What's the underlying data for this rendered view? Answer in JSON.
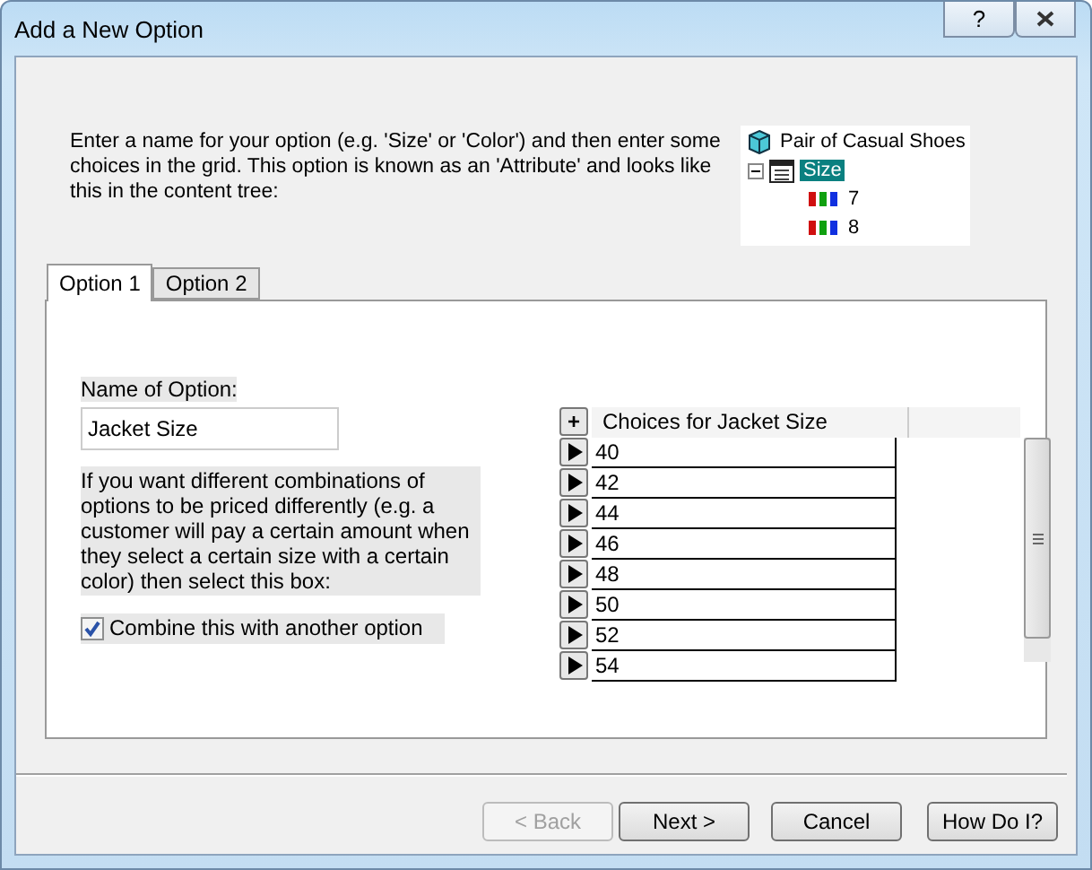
{
  "window": {
    "title": "Add a New Option",
    "help_button": "?"
  },
  "intro": "Enter a name for your option (e.g. 'Size' or 'Color') and then enter some choices in the grid. This option is known as an 'Attribute' and looks like this in the content tree:",
  "tree": {
    "label": "Pair of Casual Shoes",
    "children": [
      {
        "label": "Size",
        "selected": true,
        "expanded": true,
        "children": [
          {
            "label": "7"
          },
          {
            "label": "8"
          }
        ]
      }
    ]
  },
  "tabs": [
    {
      "label": "Option 1",
      "selected": true
    },
    {
      "label": "Option 2",
      "selected": false
    }
  ],
  "name_label": "Name of Option:",
  "name_value": "Jacket Size",
  "combine_text": "If you want different combinations of options to be priced differently (e.g. a customer will pay a certain amount when they select a certain size with a certain color) then select this box:",
  "combine_checkbox": {
    "label": "Combine this with another option",
    "checked": true
  },
  "grid": {
    "add_button": "+",
    "column": "Choices for Jacket Size",
    "rows": [
      "40",
      "42",
      "44",
      "46",
      "48",
      "50",
      "52",
      "54"
    ]
  },
  "buttons": [
    {
      "label": "< Back",
      "disabled": true
    },
    {
      "label": "Next >",
      "disabled": false
    },
    {
      "label": "Cancel",
      "disabled": false
    },
    {
      "label": "How Do I?",
      "disabled": false
    }
  ]
}
